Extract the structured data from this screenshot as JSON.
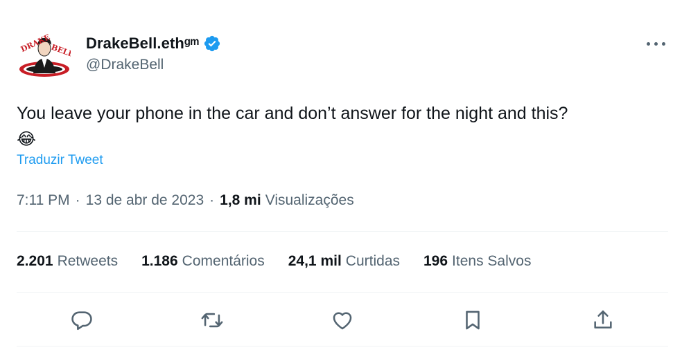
{
  "author": {
    "display_name": "DrakeBell.ethᵍᵐ",
    "handle": "@DrakeBell",
    "avatar": {
      "logo_text": "DRAKE BELL"
    },
    "verified_icon": "verified-badge-icon"
  },
  "tweet": {
    "text": "You leave your phone in the car and don’t answer for the night and this?",
    "emoji": "😂",
    "translate_label": "Traduzir Tweet",
    "time": "7:11 PM",
    "date": "13 de abr de 2023",
    "separator": "·",
    "views_count": "1,8 mi",
    "views_label": "Visualizações"
  },
  "stats": [
    {
      "count": "2.201",
      "label": "Retweets"
    },
    {
      "count": "1.186",
      "label": "Comentários"
    },
    {
      "count": "24,1 mil",
      "label": "Curtidas"
    },
    {
      "count": "196",
      "label": "Itens Salvos"
    }
  ],
  "actions": [
    "reply-icon",
    "retweet-icon",
    "like-icon",
    "bookmark-icon",
    "share-icon"
  ],
  "colors": {
    "accent": "#1d9bf0",
    "text": "#0f1419",
    "secondary": "#536471",
    "divider": "#eff3f4",
    "brand_red": "#d0202a"
  }
}
